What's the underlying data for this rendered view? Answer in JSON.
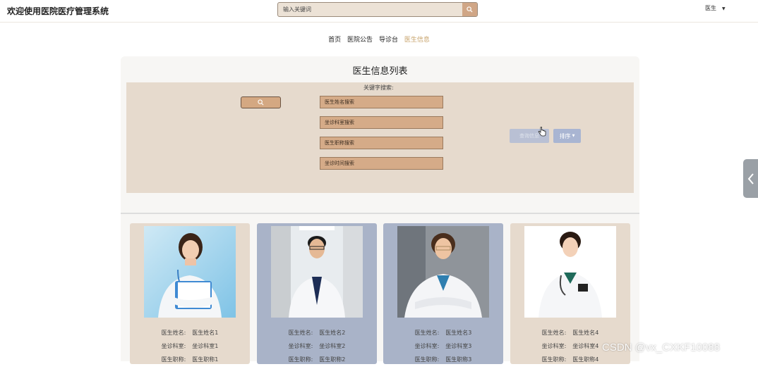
{
  "header": {
    "site_title": "欢迎使用医院医疗管理系统",
    "search_placeholder": "输入关键词",
    "user_menu": "医生"
  },
  "nav": {
    "items": [
      {
        "label": "首页",
        "active": false
      },
      {
        "label": "医院公告",
        "active": false
      },
      {
        "label": "导诊台",
        "active": false
      },
      {
        "label": "医生信息",
        "active": true
      }
    ]
  },
  "panel": {
    "title": "医生信息列表",
    "keyword_label": "关键字搜索:",
    "fields": [
      {
        "placeholder": "医生姓名搜索"
      },
      {
        "placeholder": "坐诊科室搜索"
      },
      {
        "placeholder": "医生职称搜索"
      },
      {
        "placeholder": "坐诊时间搜索"
      }
    ],
    "query_button": "查询信息",
    "sort_button": "排序"
  },
  "cards": [
    {
      "rows": [
        {
          "k": "医生姓名:",
          "v": "医生姓名1"
        },
        {
          "k": "坐诊科室:",
          "v": "坐诊科室1"
        },
        {
          "k": "医生职称:",
          "v": "医生职称1"
        }
      ],
      "bg": "#e6dacd"
    },
    {
      "rows": [
        {
          "k": "医生姓名:",
          "v": "医生姓名2"
        },
        {
          "k": "坐诊科室:",
          "v": "坐诊科室2"
        },
        {
          "k": "医生职称:",
          "v": "医生职称2"
        }
      ],
      "bg": "#a9b3c8"
    },
    {
      "rows": [
        {
          "k": "医生姓名:",
          "v": "医生姓名3"
        },
        {
          "k": "坐诊科室:",
          "v": "坐诊科室3"
        },
        {
          "k": "医生职称:",
          "v": "医生职称3"
        }
      ],
      "bg": "#a9b3c8"
    },
    {
      "rows": [
        {
          "k": "医生姓名:",
          "v": "医生姓名4"
        },
        {
          "k": "坐诊科室:",
          "v": "坐诊科室4"
        },
        {
          "k": "医生职称:",
          "v": "医生职称4"
        }
      ],
      "bg": "#e6dacd"
    }
  ],
  "watermark": "CSDN @vx_CXKF10088",
  "colors": {
    "accent": "#c7a26a",
    "filter_bg": "#e6dacd",
    "field_bg": "#d5ab88",
    "card_blue": "#a9b3c8"
  }
}
